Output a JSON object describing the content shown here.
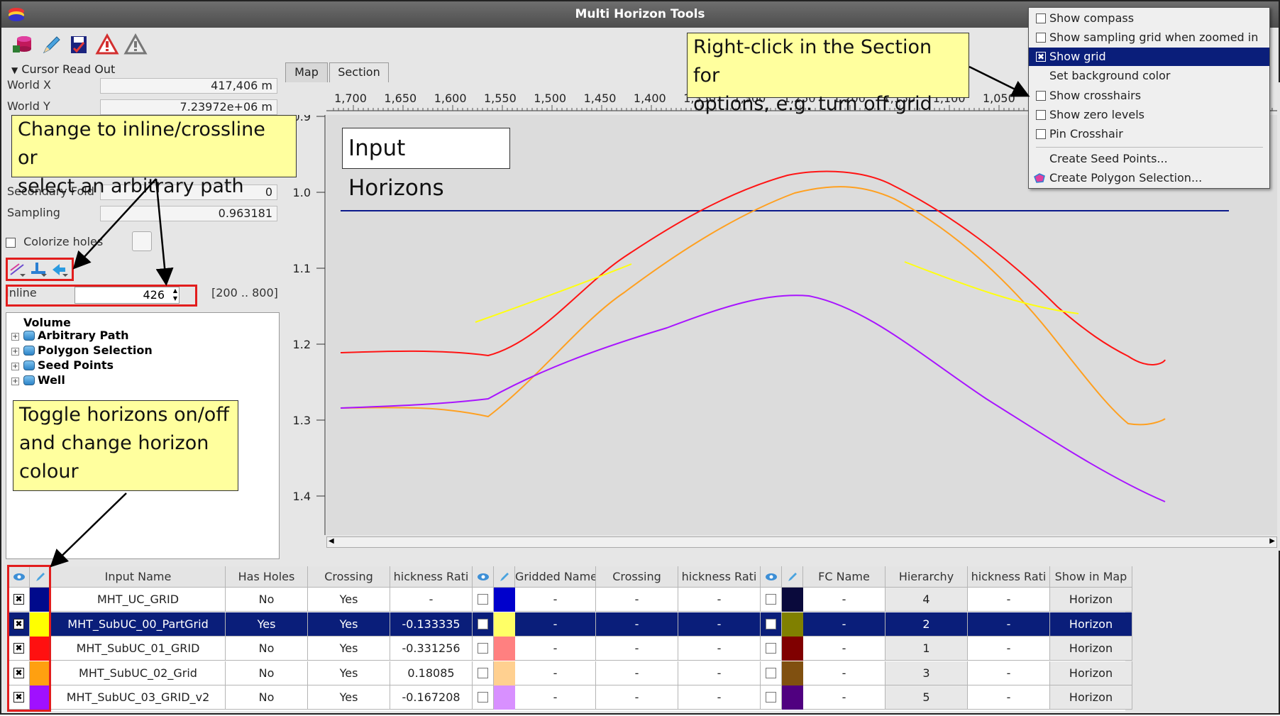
{
  "window": {
    "title": "Multi Horizon Tools"
  },
  "cursor_readout": {
    "title": "Cursor Read Out",
    "rows": [
      {
        "label": "World X",
        "value": "417,406 m"
      },
      {
        "label": "World Y",
        "value": "7.23972e+06 m"
      },
      {
        "label": "Secondary Fold",
        "value": "0"
      },
      {
        "label": "Sampling",
        "value": "0.963181"
      }
    ]
  },
  "colorize": {
    "label": "Colorize holes"
  },
  "inline": {
    "label": "Inline",
    "value": "426",
    "range": "[200 .. 800]"
  },
  "tree": {
    "root": "Volume",
    "items": [
      "Arbitrary Path",
      "Polygon Selection",
      "Seed Points",
      "Well"
    ]
  },
  "tabs": [
    {
      "label": "Map",
      "active": false
    },
    {
      "label": "Section",
      "active": true
    }
  ],
  "section": {
    "x_ticks": [
      "1,700",
      "1,650",
      "1,600",
      "1,550",
      "1,500",
      "1,450",
      "1,400",
      "1,350",
      "1,300",
      "1,250",
      "1,200",
      "1,150",
      "1,100",
      "1,050"
    ],
    "y_ticks": [
      "0.9",
      "1.0",
      "1.1",
      "1.2",
      "1.3",
      "1.4"
    ],
    "background": "#dcdcdc"
  },
  "context_menu": {
    "items": [
      {
        "label": "Show compass",
        "checkbox": true,
        "checked": false
      },
      {
        "label": "Show sampling grid when zoomed in",
        "checkbox": true,
        "checked": false
      },
      {
        "label": "Show grid",
        "checkbox": true,
        "checked": true,
        "highlighted": true
      },
      {
        "label": "Set background color",
        "checkbox": false
      },
      {
        "label": "Show crosshairs",
        "checkbox": true,
        "checked": false
      },
      {
        "label": "Show zero levels",
        "checkbox": true,
        "checked": false
      },
      {
        "label": "Pin Crosshair",
        "checkbox": true,
        "checked": false
      },
      {
        "label": "Create Seed Points...",
        "checkbox": false
      },
      {
        "label": "Create Polygon Selection...",
        "checkbox": false,
        "icon": "polygon-icon"
      }
    ]
  },
  "callouts": {
    "inline": [
      "Change to inline/crossline or",
      "select an arbitrary path"
    ],
    "toggle": [
      "Toggle horizons on/off",
      "and change horizon",
      "colour"
    ],
    "right_click": [
      "Right-click in the Section for",
      "options, e.g. turn off grid"
    ],
    "input_horizons": "Input Horizons"
  },
  "table": {
    "headers": [
      "",
      "",
      "Input Name",
      "Has Holes",
      "Crossing",
      "hickness Rati",
      "",
      "",
      "Gridded Name",
      "Crossing",
      "hickness Rati",
      "",
      "",
      "FC Name",
      "Hierarchy",
      "hickness Rati",
      "Show in Map"
    ],
    "rows": [
      {
        "name": "MHT_UC_GRID",
        "holes": "No",
        "crossing": "Yes",
        "ratio": "-",
        "color": "#000a8c",
        "grid_color": "#0000cc",
        "fc_color": "#0a0a3c",
        "g_name": "-",
        "g_cross": "-",
        "g_ratio": "-",
        "fc_name": "-",
        "hierarchy": "4",
        "fc_ratio": "-",
        "show": "Horizon",
        "selected": false
      },
      {
        "name": "MHT_SubUC_00_PartGrid",
        "holes": "Yes",
        "crossing": "Yes",
        "ratio": "-0.133335",
        "color": "#ffff00",
        "grid_color": "#ffff66",
        "fc_color": "#808000",
        "g_name": "-",
        "g_cross": "-",
        "g_ratio": "-",
        "fc_name": "-",
        "hierarchy": "2",
        "fc_ratio": "-",
        "show": "Horizon",
        "selected": true
      },
      {
        "name": "MHT_SubUC_01_GRID",
        "holes": "No",
        "crossing": "Yes",
        "ratio": "-0.331256",
        "color": "#ff1010",
        "grid_color": "#ff8080",
        "fc_color": "#800000",
        "g_name": "-",
        "g_cross": "-",
        "g_ratio": "-",
        "fc_name": "-",
        "hierarchy": "1",
        "fc_ratio": "-",
        "show": "Horizon",
        "selected": false
      },
      {
        "name": "MHT_SubUC_02_Grid",
        "holes": "No",
        "crossing": "Yes",
        "ratio": "0.18085",
        "color": "#ffa010",
        "grid_color": "#ffd090",
        "fc_color": "#805010",
        "g_name": "-",
        "g_cross": "-",
        "g_ratio": "-",
        "fc_name": "-",
        "hierarchy": "3",
        "fc_ratio": "-",
        "show": "Horizon",
        "selected": false
      },
      {
        "name": "MHT_SubUC_03_GRID_v2",
        "holes": "No",
        "crossing": "Yes",
        "ratio": "-0.167208",
        "color": "#a010ff",
        "grid_color": "#d890ff",
        "fc_color": "#500080",
        "g_name": "-",
        "g_cross": "-",
        "g_ratio": "-",
        "fc_name": "-",
        "hierarchy": "5",
        "fc_ratio": "-",
        "show": "Horizon",
        "selected": false
      }
    ]
  },
  "icons": [
    "database-icon",
    "pencil-icon",
    "save-icon",
    "warning-red-icon",
    "warning-grey-icon",
    "eye-icon",
    "pencil-icon"
  ]
}
